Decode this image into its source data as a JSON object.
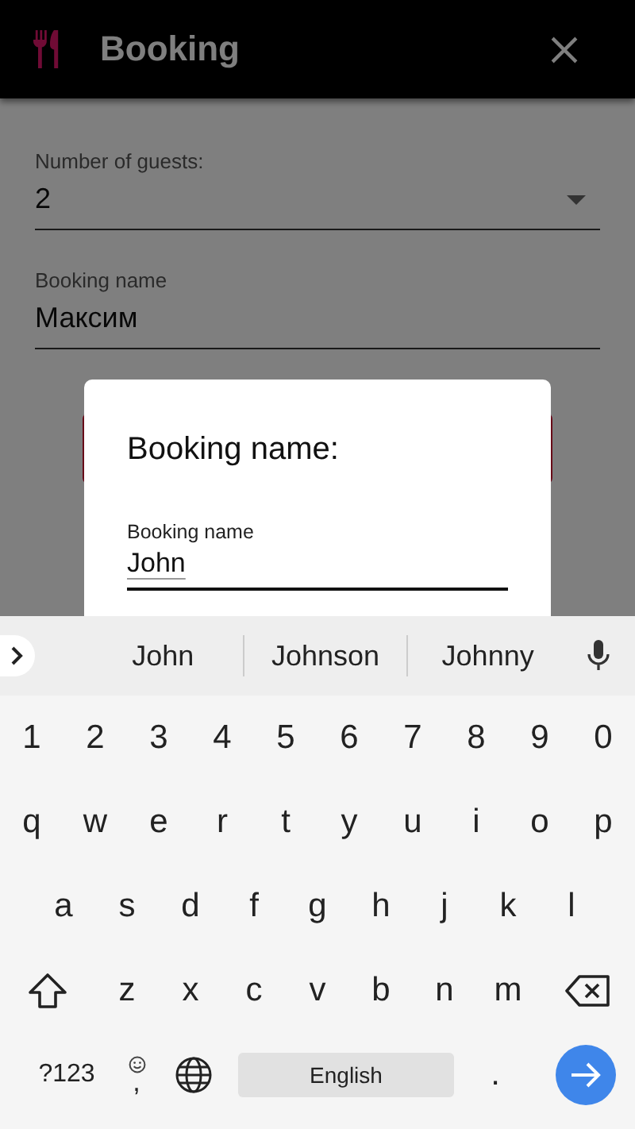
{
  "header": {
    "title": "Booking"
  },
  "form": {
    "fields": [
      {
        "kind": "dropdown",
        "label": "Number of guests:",
        "value": "2"
      },
      {
        "kind": "text",
        "label": "Booking name",
        "value": "Максим"
      }
    ]
  },
  "dialog": {
    "title": "Booking name:",
    "field": {
      "label": "Booking name",
      "value": "John"
    }
  },
  "keyboard": {
    "suggestions": [
      "John",
      "Johnson",
      "Johnny"
    ],
    "rows": [
      [
        {
          "kind": "char",
          "label": "1"
        },
        {
          "kind": "char",
          "label": "2"
        },
        {
          "kind": "char",
          "label": "3"
        },
        {
          "kind": "char",
          "label": "4"
        },
        {
          "kind": "char",
          "label": "5"
        },
        {
          "kind": "char",
          "label": "6"
        },
        {
          "kind": "char",
          "label": "7"
        },
        {
          "kind": "char",
          "label": "8"
        },
        {
          "kind": "char",
          "label": "9"
        },
        {
          "kind": "char",
          "label": "0"
        }
      ],
      [
        {
          "kind": "char",
          "label": "q"
        },
        {
          "kind": "char",
          "label": "w"
        },
        {
          "kind": "char",
          "label": "e"
        },
        {
          "kind": "char",
          "label": "r"
        },
        {
          "kind": "char",
          "label": "t"
        },
        {
          "kind": "char",
          "label": "y"
        },
        {
          "kind": "char",
          "label": "u"
        },
        {
          "kind": "char",
          "label": "i"
        },
        {
          "kind": "char",
          "label": "o"
        },
        {
          "kind": "char",
          "label": "p"
        }
      ],
      [
        {
          "kind": "char",
          "label": "a"
        },
        {
          "kind": "char",
          "label": "s"
        },
        {
          "kind": "char",
          "label": "d"
        },
        {
          "kind": "char",
          "label": "f"
        },
        {
          "kind": "char",
          "label": "g"
        },
        {
          "kind": "char",
          "label": "h"
        },
        {
          "kind": "char",
          "label": "j"
        },
        {
          "kind": "char",
          "label": "k"
        },
        {
          "kind": "char",
          "label": "l"
        }
      ],
      [
        {
          "kind": "shift"
        },
        {
          "kind": "char",
          "label": "z"
        },
        {
          "kind": "char",
          "label": "x"
        },
        {
          "kind": "char",
          "label": "c"
        },
        {
          "kind": "char",
          "label": "v"
        },
        {
          "kind": "char",
          "label": "b"
        },
        {
          "kind": "char",
          "label": "n"
        },
        {
          "kind": "char",
          "label": "m"
        },
        {
          "kind": "backspace"
        }
      ],
      [
        {
          "kind": "symbols",
          "label": "?123"
        },
        {
          "kind": "comma",
          "label": ","
        },
        {
          "kind": "globe"
        },
        {
          "kind": "space",
          "label": "English"
        },
        {
          "kind": "char",
          "label": "."
        },
        {
          "kind": "enter"
        }
      ]
    ]
  }
}
